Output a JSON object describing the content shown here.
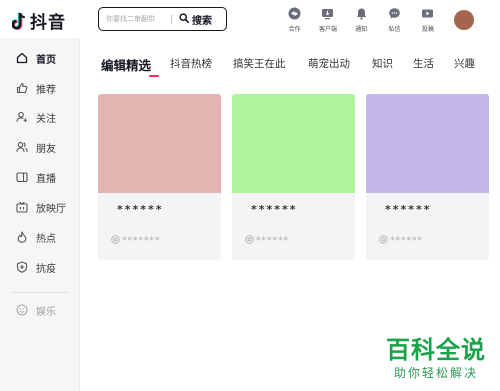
{
  "header": {
    "logo_text": "抖音",
    "search": {
      "placeholder": "你要找二审翻供",
      "button_label": "搜索"
    },
    "icons": [
      {
        "label": "合作",
        "icon": "handshake-icon"
      },
      {
        "label": "客户端",
        "icon": "desktop-client-icon"
      },
      {
        "label": "通知",
        "icon": "bell-icon"
      },
      {
        "label": "私信",
        "icon": "message-icon"
      },
      {
        "label": "投稿",
        "icon": "upload-video-icon"
      }
    ]
  },
  "sidebar": {
    "items": [
      {
        "label": "首页",
        "icon": "home-icon",
        "active": true
      },
      {
        "label": "推荐",
        "icon": "thumbs-up-icon"
      },
      {
        "label": "关注",
        "icon": "follow-user-icon"
      },
      {
        "label": "朋友",
        "icon": "friends-icon"
      },
      {
        "label": "直播",
        "icon": "live-tv-icon"
      },
      {
        "label": "放映厅",
        "icon": "cinema-icon"
      },
      {
        "label": "热点",
        "icon": "flame-icon"
      },
      {
        "label": "抗疫",
        "icon": "shield-cross-icon"
      },
      {
        "label": "娱乐",
        "icon": "smile-icon",
        "muted": true
      }
    ]
  },
  "main": {
    "tabs": [
      {
        "label": "编辑精选",
        "active": true
      },
      {
        "label": "抖音热榜"
      },
      {
        "label": "搞笑王在此"
      },
      {
        "label": "萌宠出动"
      },
      {
        "label": "知识"
      },
      {
        "label": "生活"
      },
      {
        "label": "兴趣"
      }
    ],
    "cards": [
      {
        "title": "******",
        "author": "*******",
        "color": "#e2b5b3"
      },
      {
        "title": "******",
        "author": "******",
        "color": "#adf49a"
      },
      {
        "title": "******",
        "author": "******",
        "color": "#c4b7ea"
      }
    ]
  },
  "colors": {
    "accent": "#fe2c55",
    "watermark": "#1aa34a"
  },
  "watermark": {
    "main": "百科全说",
    "sub": "助你轻松解决"
  }
}
